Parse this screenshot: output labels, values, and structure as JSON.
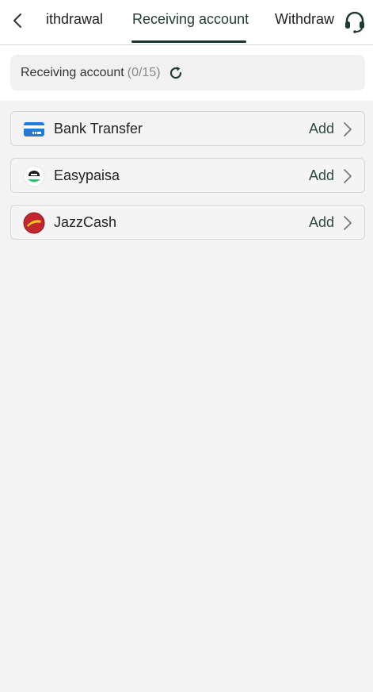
{
  "header": {
    "tabs": [
      {
        "label": "ithdrawal"
      },
      {
        "label": "Receiving account",
        "active": true
      },
      {
        "label": "Withdraw"
      }
    ],
    "back_icon": "chevron-left-icon",
    "support_icon": "headset-icon"
  },
  "account_counter": {
    "label": "Receiving account",
    "count": "(0/15)",
    "refresh_icon": "refresh-icon"
  },
  "methods": [
    {
      "name": "Bank Transfer",
      "action": "Add",
      "icon": "bank-card-icon"
    },
    {
      "name": "Easypaisa",
      "action": "Add",
      "icon": "easypaisa-logo"
    },
    {
      "name": "JazzCash",
      "action": "Add",
      "icon": "jazzcash-logo"
    }
  ],
  "colors": {
    "active_tab_underline": "#15342f",
    "add_text": "#2e4a45",
    "background": "#f3f3f3"
  }
}
